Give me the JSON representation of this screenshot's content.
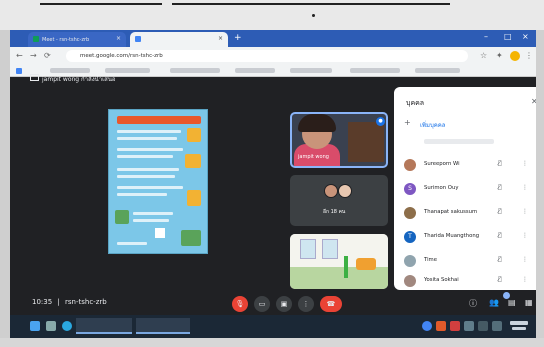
{
  "browser": {
    "tabs": [
      {
        "label": "Meet - rsn-tshc-zrb",
        "icon_color": "#0f9d58"
      },
      {
        "label": "",
        "icon_color": "#4285f4"
      }
    ],
    "address": "meet.google.com/rsn-tshc-zrb"
  },
  "meeting": {
    "presenter_label": "jampit wong กำลังนำเสนอ",
    "code": "rsn-tshc-zrb",
    "time": "10:35",
    "tiles": [
      {
        "label": "jampit wong"
      },
      {
        "label": "อีก 18 คน"
      }
    ]
  },
  "panel": {
    "title": "บุคคล",
    "add_label": "เพิ่มบุคคล",
    "participants": [
      {
        "name": "Sureeporn Wi",
        "avatar_color": "#b5785a"
      },
      {
        "name": "Surimon Ouy",
        "avatar_color": "#7e57c2",
        "initial": "S"
      },
      {
        "name": "Thanapat sakussum",
        "avatar_color": "#8d6e4a"
      },
      {
        "name": "Tharida Muangthong",
        "avatar_color": "#1565c0",
        "initial": "T"
      },
      {
        "name": "Time",
        "avatar_color": "#90a4ae"
      },
      {
        "name": "Yosita Sokhai",
        "avatar_color": "#a1887f"
      }
    ]
  },
  "colors": {
    "accent": "#1a73e8",
    "end_call": "#ea4335",
    "taskbar": "#1b2836"
  }
}
